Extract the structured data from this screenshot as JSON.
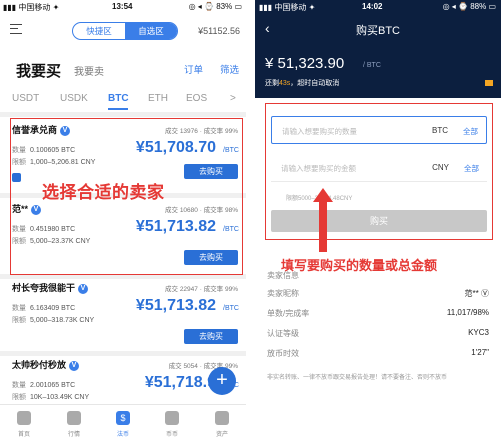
{
  "left": {
    "status": {
      "carrier": "▮▮▮ 中国移动 ✦",
      "time": "13:54",
      "right": "◎ ◂ ⌚ 83% ▭"
    },
    "nav": {
      "seg_left": "快捷区",
      "seg_right": "自选区",
      "balance": "¥51152.56"
    },
    "trade_tabs": {
      "buy": "我要买",
      "sell": "我要卖",
      "orders": "订单",
      "filter": "筛选"
    },
    "coin_tabs": [
      "USDT",
      "USDK",
      "BTC",
      "ETH",
      "EOS",
      ">"
    ],
    "qty_label": "数量",
    "limit_label": "限额",
    "buy_label": "去购买",
    "v_badge": "V",
    "offers": [
      {
        "name": "信誉承兑商",
        "stats": "成交 13976 · 成交率 99%",
        "qty": "0.100605 BTC",
        "limit": "1,000–5,206.81 CNY",
        "price": "¥51,708.70",
        "unit": "/BTC"
      },
      {
        "name": "范**",
        "stats": "成交 10680 · 成交率 98%",
        "qty": "0.451980 BTC",
        "limit": "5,000–23.37K CNY",
        "price": "¥51,713.82",
        "unit": "/BTC"
      },
      {
        "name": "村长夸我很能干",
        "stats": "成交 22947 · 成交率 99%",
        "qty": "6.163409 BTC",
        "limit": "5,000–318.73K CNY",
        "price": "¥51,713.82",
        "unit": "/BTC"
      },
      {
        "name": "太帅秒付秒放",
        "stats": "成交 5054 · 成交率 99%",
        "qty": "2.001065 BTC",
        "limit": "10K–103.49K CNY",
        "price": "¥51,718.9",
        "unit": "/BTC"
      }
    ],
    "annotation": "选择合适的卖家",
    "fab": "+",
    "tabbar": [
      {
        "label": "首页",
        "icon": "home-icon"
      },
      {
        "label": "行情",
        "icon": "chart-icon"
      },
      {
        "label": "法币",
        "icon": "currency-icon",
        "glyph": "$"
      },
      {
        "label": "币币",
        "icon": "exchange-icon"
      },
      {
        "label": "资产",
        "icon": "wallet-icon"
      }
    ]
  },
  "right": {
    "status": {
      "carrier": "▮▮▮ 中国移动 ✦",
      "time": "14:02",
      "right": "◎ ◂ ⌚ 88% ▭"
    },
    "back": "‹",
    "title": "购买BTC",
    "price": "¥ 51,323.90",
    "price_unit": "/ BTC",
    "countdown_prefix": "还剩",
    "countdown_value": "43s",
    "countdown_suffix": "，超时自动取消",
    "qty_field": {
      "placeholder": "请输入想要购买的数量",
      "currency": "BTC",
      "all": "全部"
    },
    "amount_field": {
      "placeholder": "请输入想要购买的金额",
      "currency": "CNY",
      "all": "全部"
    },
    "limit_hint": "限额5000–23374.48CNY",
    "submit": "购买",
    "annotation": "填写要购买的数量或总金额",
    "details": [
      {
        "k": "卖家信息",
        "v": ""
      },
      {
        "k": "卖家昵称",
        "v": "范** Ⓥ"
      },
      {
        "k": "单数/完成率",
        "v": "11,017/98%"
      },
      {
        "k": "认证等级",
        "v": "KYC3"
      },
      {
        "k": "放币时效",
        "v": "1'27\""
      }
    ],
    "footnote": "非实名转账、一律不放币跟交易报告处理！请不要备注、否则不放币"
  },
  "colors": {
    "accent": "#3a7ee8",
    "price_blue": "#2a6fd6",
    "annotation_red": "#e53935",
    "header_navy": "#0c1f3f"
  }
}
